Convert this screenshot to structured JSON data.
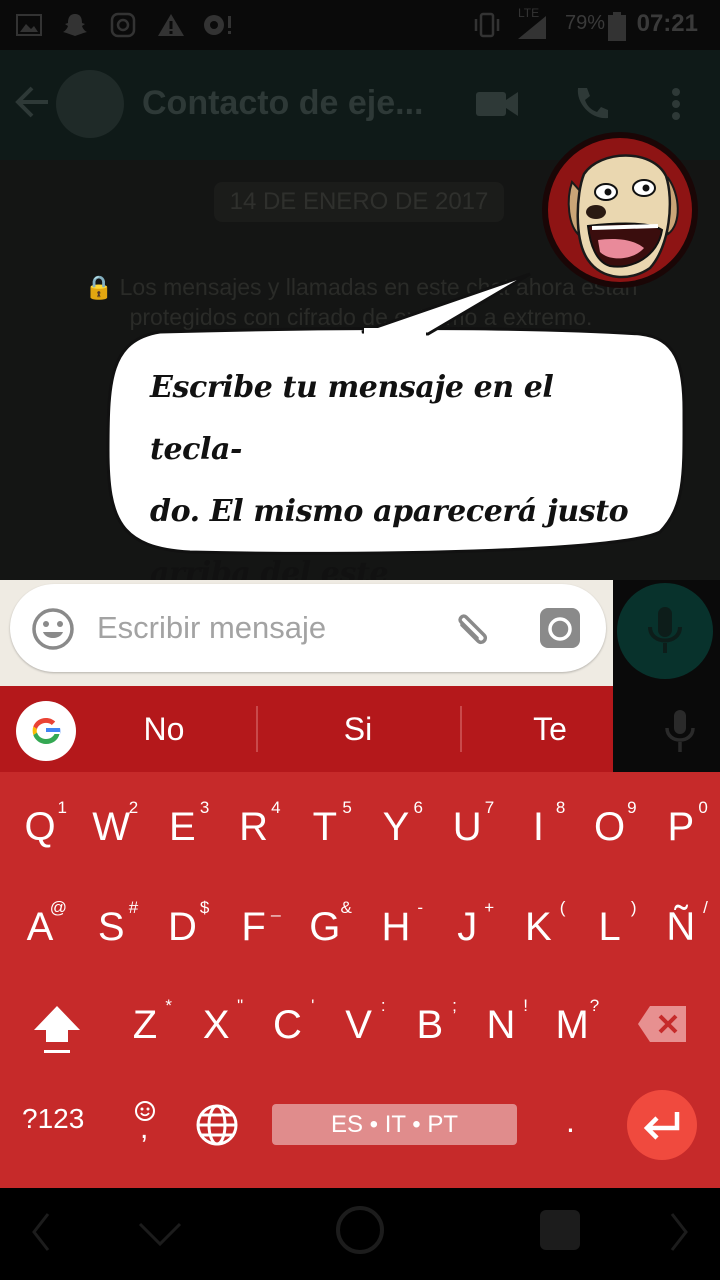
{
  "status_bar": {
    "battery": "79%",
    "time": "07:21",
    "network": "LTE"
  },
  "app_bar": {
    "contact_name": "Contacto de eje..."
  },
  "chat": {
    "date": "14 DE ENERO DE 2017",
    "encryption_note": "🔒 Los mensajes y llamadas en este chat ahora están protegidos con cifrado de extremo a extremo."
  },
  "tutorial": {
    "line1": "Escribe tu mensaje en el tecla-",
    "line2": "do. El mismo aparecerá justo",
    "line3": "arriba del este"
  },
  "input": {
    "placeholder": "Escribir mensaje"
  },
  "suggestions": [
    "No",
    "Si",
    "Te"
  ],
  "keyboard": {
    "row1": [
      {
        "k": "Q",
        "h": "1"
      },
      {
        "k": "W",
        "h": "2"
      },
      {
        "k": "E",
        "h": "3"
      },
      {
        "k": "R",
        "h": "4"
      },
      {
        "k": "T",
        "h": "5"
      },
      {
        "k": "Y",
        "h": "6"
      },
      {
        "k": "U",
        "h": "7"
      },
      {
        "k": "I",
        "h": "8"
      },
      {
        "k": "O",
        "h": "9"
      },
      {
        "k": "P",
        "h": "0"
      }
    ],
    "row2": [
      {
        "k": "A",
        "h": "@"
      },
      {
        "k": "S",
        "h": "#"
      },
      {
        "k": "D",
        "h": "$"
      },
      {
        "k": "F",
        "h": "_"
      },
      {
        "k": "G",
        "h": "&"
      },
      {
        "k": "H",
        "h": "-"
      },
      {
        "k": "J",
        "h": "+"
      },
      {
        "k": "K",
        "h": "("
      },
      {
        "k": "L",
        "h": ")"
      },
      {
        "k": "Ñ",
        "h": "/"
      }
    ],
    "row3": [
      {
        "k": "Z",
        "h": "*"
      },
      {
        "k": "X",
        "h": "\""
      },
      {
        "k": "C",
        "h": "'"
      },
      {
        "k": "V",
        "h": ":"
      },
      {
        "k": "B",
        "h": ";"
      },
      {
        "k": "N",
        "h": "!"
      },
      {
        "k": "M",
        "h": "?"
      }
    ],
    "symbols_label": "?123",
    "comma": ",",
    "space_label": "ES • IT • PT",
    "period": "."
  },
  "colors": {
    "keyboard": "#c62a2a",
    "suggestion_bar": "#b4181b",
    "enter": "#f04a3e"
  }
}
